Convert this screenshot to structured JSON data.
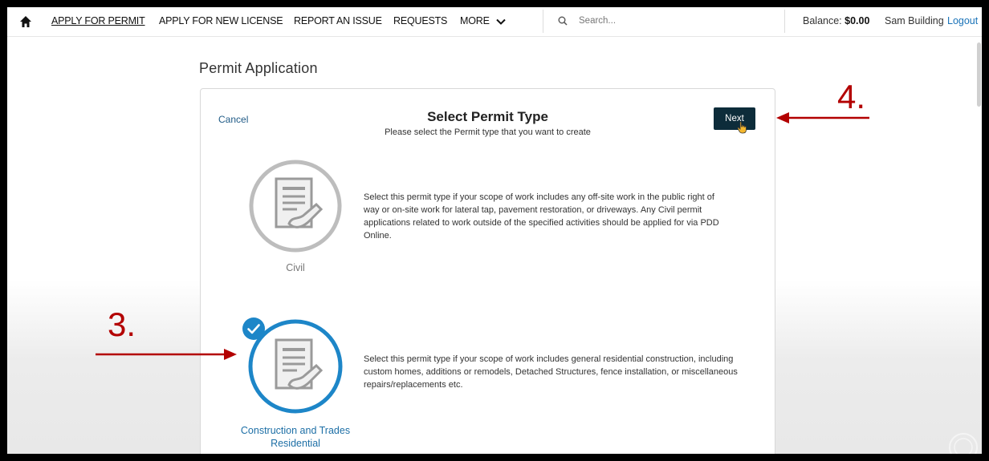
{
  "nav": {
    "items": [
      "APPLY FOR PERMIT",
      "APPLY FOR NEW LICENSE",
      "REPORT AN ISSUE",
      "REQUESTS",
      "MORE"
    ],
    "search_placeholder": "Search...",
    "balance_label": "Balance:",
    "balance_value": "$0.00",
    "user_name": "Sam Building",
    "logout": "Logout"
  },
  "page": {
    "title": "Permit Application"
  },
  "card": {
    "cancel": "Cancel",
    "title": "Select Permit Type",
    "subtitle": "Please select the Permit type that you want to create",
    "next": "Next"
  },
  "options": [
    {
      "label": "Civil",
      "description": "Select this permit type if your scope of work includes any off-site work in the public right of way or on-site work for lateral tap, pavement restoration, or driveways. Any Civil permit applications related to work outside of the specified activities should be applied for via PDD Online.",
      "selected": false
    },
    {
      "label_line1": "Construction and Trades",
      "label_line2": "Residential",
      "description": "Select this permit type if your scope of work includes general residential construction, including custom homes, additions or remodels, Detached Structures, fence installation, or miscellaneous repairs/replacements etc.",
      "selected": true
    }
  ],
  "annotations": {
    "step3": "3.",
    "step4": "4."
  },
  "colors": {
    "selected": "#1d86c8",
    "unselected": "#bdbdbd",
    "annotation": "#b30000",
    "next_bg": "#0d2c3a"
  }
}
